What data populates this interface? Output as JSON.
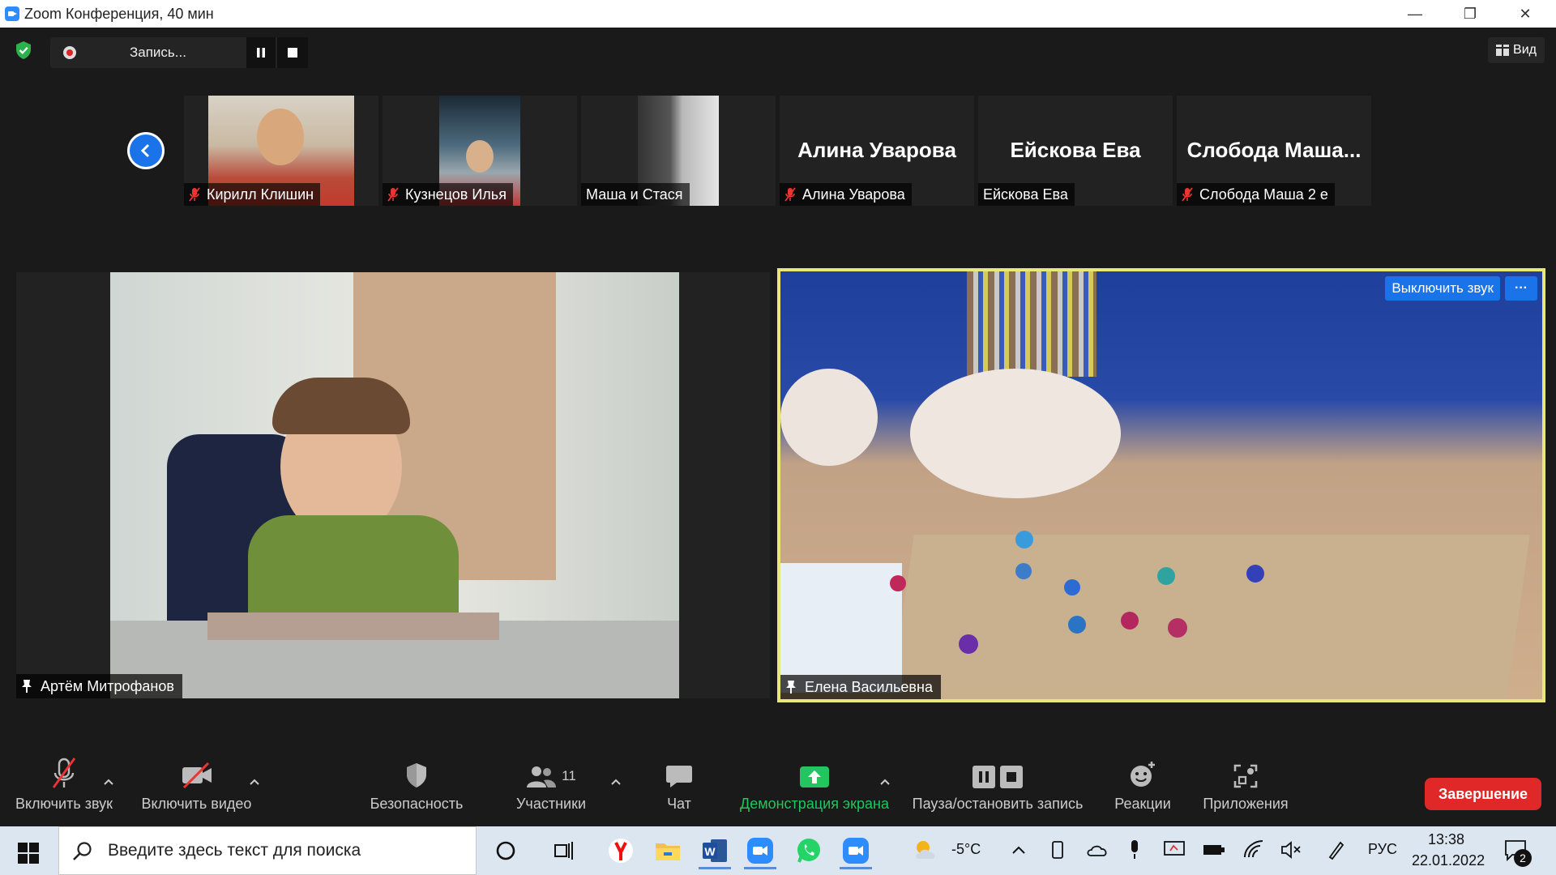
{
  "window": {
    "title": "Zoom Конференция, 40 мин",
    "min_glyph": "—",
    "restore_glyph": "❐",
    "close_glyph": "✕"
  },
  "recording": {
    "label": "Запись..."
  },
  "view_button": {
    "label": "Вид"
  },
  "thumbnails": [
    {
      "name": "Кирилл Клишин",
      "muted": true,
      "video": true,
      "big_name": ""
    },
    {
      "name": "Кузнецов Илья",
      "muted": true,
      "video": true,
      "big_name": ""
    },
    {
      "name": "Маша и Стася",
      "muted": false,
      "video": true,
      "big_name": ""
    },
    {
      "name": "Алина Уварова",
      "muted": true,
      "video": false,
      "big_name": "Алина Уварова"
    },
    {
      "name": "Ейскова Ева",
      "muted": false,
      "video": false,
      "big_name": "Ейскова Ева"
    },
    {
      "name": "Слобода Маша 2 е",
      "muted": true,
      "video": false,
      "big_name": "Слобода  Маша..."
    }
  ],
  "main_left": {
    "name": "Артём Митрофанов"
  },
  "main_right": {
    "name": "Елена Васильевна",
    "unmute_label": "Выключить звук",
    "more_label": "···"
  },
  "toolbar": {
    "unmute": "Включить звук",
    "start_video": "Включить видео",
    "security": "Безопасность",
    "participants": "Участники",
    "participants_count": "11",
    "chat": "Чат",
    "share_screen": "Демонстрация экрана",
    "pause_stop_recording": "Пауза/остановить запись",
    "reactions": "Реакции",
    "apps": "Приложения",
    "end": "Завершение"
  },
  "colors": {
    "accent_blue": "#1a73e8",
    "share_green": "#22c55e",
    "end_red": "#e02828",
    "active_speaker": "#e8e87a"
  },
  "taskbar": {
    "search_placeholder": "Введите здесь текст для поиска",
    "weather_temp": "-5°C",
    "language": "РУС",
    "time": "13:38",
    "date": "22.01.2022",
    "notification_count": "2"
  }
}
